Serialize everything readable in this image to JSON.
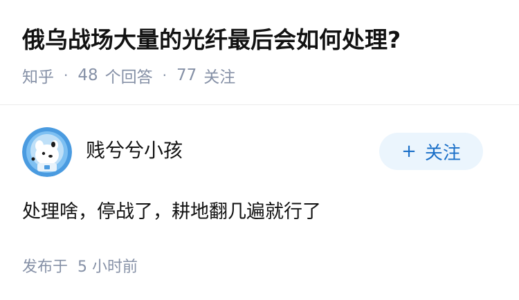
{
  "question": {
    "title": "俄乌战场大量的光纤最后会如何处理?",
    "source": "知乎",
    "separator": "·",
    "answer_count": "48",
    "answer_label": "个回答",
    "follower_count": "77",
    "follower_label": "关注"
  },
  "answer": {
    "author_name": "贱兮兮小孩",
    "follow_button": {
      "plus": "+",
      "label": "关注"
    },
    "content": "处理啥，停战了，耕地翻几遍就行了",
    "published_label": "发布于",
    "published_time": "5 小时前"
  },
  "colors": {
    "title": "#121212",
    "meta": "#8590a6",
    "follow_bg": "#ebf5fd",
    "follow_text": "#1a6fc8",
    "avatar_bg": "#4a9be0"
  },
  "icons": {
    "avatar": "cartoon-dog-astronaut-avatar"
  }
}
